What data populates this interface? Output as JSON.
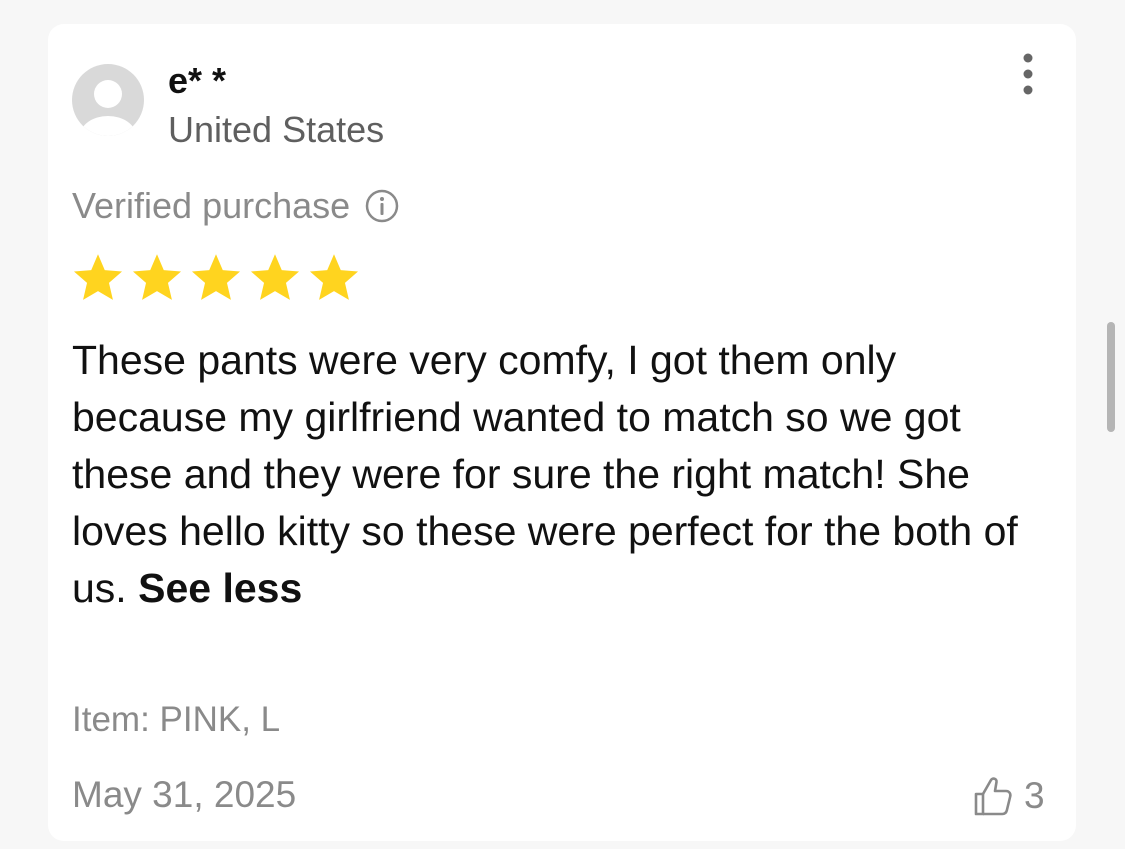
{
  "review": {
    "username": "e* *",
    "country": "United States",
    "verified_label": "Verified purchase",
    "rating": 5,
    "text": "These pants were very comfy, I got them only because my girlfriend wanted to match so we got these and they were for sure the right match! She loves hello kitty so these were perfect for the both of us.",
    "see_less_label": "See less",
    "item": "Item: PINK, L",
    "date": "May 31, 2025",
    "like_count": "3"
  },
  "icons": {
    "more": "more-vertical-icon",
    "info": "info-icon",
    "star": "star-icon",
    "like": "thumbs-up-icon",
    "avatar": "user-avatar-icon"
  },
  "colors": {
    "star": "#FFD41F",
    "primary_text": "#111111",
    "secondary_text": "#8a8a8a"
  }
}
